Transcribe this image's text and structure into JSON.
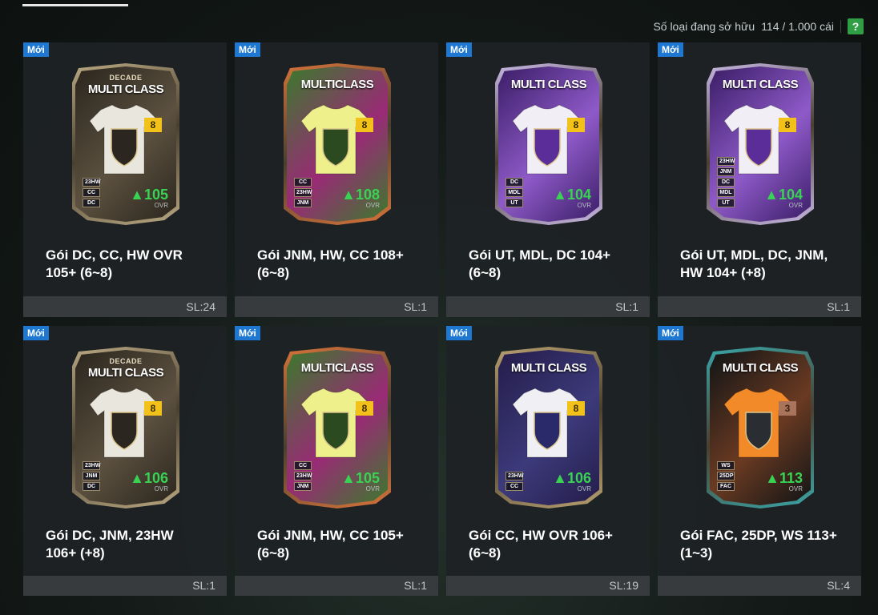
{
  "owned": {
    "label": "Số loại đang sở hữu",
    "count": "114 / 1.000 cái",
    "help": "?"
  },
  "packs": [
    {
      "badge": "Mới",
      "decade": "DECADE",
      "card_title": "MULTI CLASS",
      "level": "8",
      "ovr": "105",
      "ovr_label": "OVR",
      "tags": [
        "23HW",
        "CC",
        "DC"
      ],
      "name": "Gói DC, CC, HW OVR 105+ (6~8)",
      "qty": "SL:24",
      "theme": "gold"
    },
    {
      "badge": "Mới",
      "decade": "",
      "card_title": "MULTICLASS",
      "level": "8",
      "ovr": "108",
      "ovr_label": "OVR",
      "tags": [
        "CC",
        "23HW",
        "JNM"
      ],
      "name": "Gói JNM, HW, CC 108+ (6~8)",
      "qty": "SL:1",
      "theme": "green"
    },
    {
      "badge": "Mới",
      "decade": "",
      "card_title": "MULTI CLASS",
      "level": "8",
      "ovr": "104",
      "ovr_label": "OVR",
      "tags": [
        "DC",
        "MDL",
        "UT"
      ],
      "name": "Gói UT, MDL, DC 104+ (6~8)",
      "qty": "SL:1",
      "theme": "purple"
    },
    {
      "badge": "Mới",
      "decade": "",
      "card_title": "MULTI CLASS",
      "level": "8",
      "ovr": "104",
      "ovr_label": "OVR",
      "tags": [
        "23HW",
        "JNM",
        "DC",
        "MDL",
        "UT"
      ],
      "name": "Gói UT, MDL, DC, JNM, HW 104+ (+8)",
      "qty": "SL:1",
      "theme": "purple"
    },
    {
      "badge": "Mới",
      "decade": "DECADE",
      "card_title": "MULTI CLASS",
      "level": "8",
      "ovr": "106",
      "ovr_label": "OVR",
      "tags": [
        "23HW",
        "JNM",
        "DC"
      ],
      "name": "Gói DC, JNM, 23HW 106+ (+8)",
      "qty": "SL:1",
      "theme": "gold"
    },
    {
      "badge": "Mới",
      "decade": "",
      "card_title": "MULTICLASS",
      "level": "8",
      "ovr": "105",
      "ovr_label": "OVR",
      "tags": [
        "CC",
        "23HW",
        "JNM"
      ],
      "name": "Gói JNM, HW, CC 105+ (6~8)",
      "qty": "SL:1",
      "theme": "green"
    },
    {
      "badge": "Mới",
      "decade": "",
      "card_title": "MULTI CLASS",
      "level": "8",
      "ovr": "106",
      "ovr_label": "OVR",
      "tags": [
        "23HW",
        "CC"
      ],
      "name": "Gói CC, HW OVR 106+ (6~8)",
      "qty": "SL:19",
      "theme": "navy"
    },
    {
      "badge": "Mới",
      "decade": "",
      "card_title": "MULTI CLASS",
      "level": "3",
      "ovr": "113",
      "ovr_label": "OVR",
      "tags": [
        "WS",
        "25DP",
        "FAC"
      ],
      "name": "Gói FAC, 25DP, WS 113+ (1~3)",
      "qty": "SL:4",
      "theme": "teal"
    }
  ],
  "themes": {
    "gold": {
      "frame": "#b9a882",
      "bg1": "#2a251d",
      "bg2": "#5c5140",
      "shirt": "#e9e6dd",
      "crest": "#2b2620",
      "emblem": "DC"
    },
    "green": {
      "frame": "#d8733a",
      "bg1": "#3a7a2c",
      "bg2": "#9a2a76",
      "shirt": "#eef08c",
      "crest": "#2c4a1f",
      "emblem": "JNM"
    },
    "purple": {
      "frame": "#c8b8e6",
      "bg1": "#3a1d66",
      "bg2": "#8e5ac8",
      "shirt": "#f1eff5",
      "crest": "#5b2d99",
      "emblem": "UT"
    },
    "navy": {
      "frame": "#b8a070",
      "bg1": "#241c4a",
      "bg2": "#3c3a7a",
      "shirt": "#f0f0f4",
      "crest": "#2a2a6a",
      "emblem": "CC"
    },
    "teal": {
      "frame": "#3aa6a8",
      "bg1": "#101416",
      "bg2": "#6a3a22",
      "shirt": "#f28a2a",
      "crest": "#2a2e32",
      "emblem": "FAC"
    }
  }
}
